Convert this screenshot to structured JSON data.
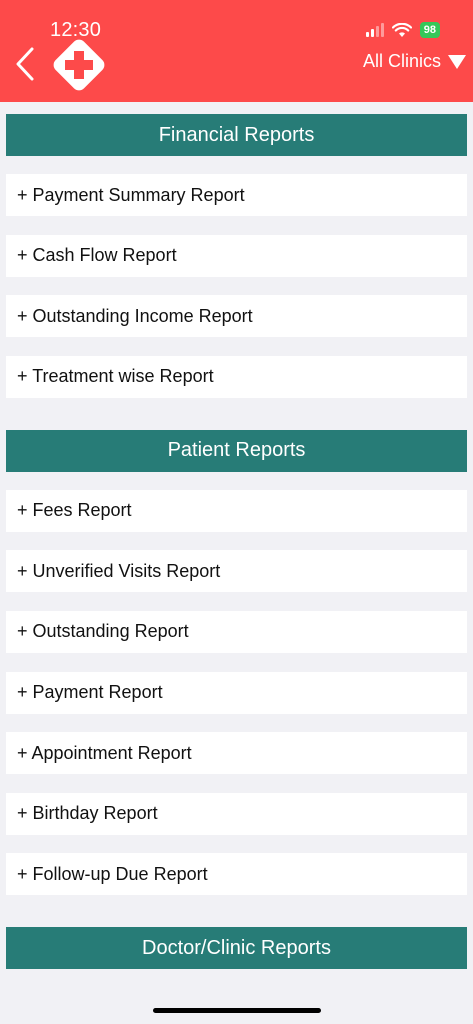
{
  "status_bar": {
    "time": "12:30",
    "battery": "98"
  },
  "header": {
    "clinic_selector": "All Clinics"
  },
  "sections": [
    {
      "title": "Financial Reports",
      "items": [
        "+ Payment Summary Report",
        "+ Cash Flow Report",
        "+ Outstanding Income Report",
        "+ Treatment wise Report"
      ]
    },
    {
      "title": "Patient Reports",
      "items": [
        "+ Fees Report",
        "+ Unverified Visits Report",
        "+ Outstanding Report",
        "+ Payment Report",
        "+ Appointment Report",
        "+ Birthday Report",
        "+ Follow-up Due Report"
      ]
    },
    {
      "title": "Doctor/Clinic Reports",
      "items": []
    }
  ],
  "colors": {
    "header_bg": "#fd4a4a",
    "section_bg": "#277c77",
    "page_bg": "#f1f1f5",
    "battery": "#35c759"
  }
}
